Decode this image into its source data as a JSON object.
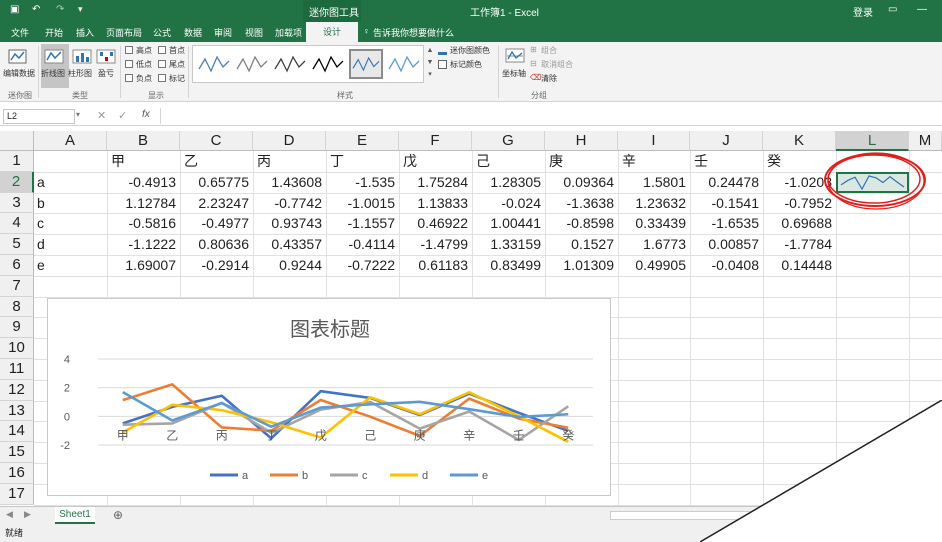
{
  "window": {
    "title": "工作簿1 - Excel",
    "context_tool": "迷你图工具",
    "signin": "登录"
  },
  "tabs": [
    "文件",
    "开始",
    "插入",
    "页面布局",
    "公式",
    "数据",
    "审阅",
    "视图",
    "加载项",
    "设计"
  ],
  "tell_me": "告诉我你想要做什么",
  "ribbon": {
    "edit_data": "编辑数据",
    "type_line": "折线图",
    "type_column": "柱形图",
    "type_winloss": "盈亏",
    "show": {
      "high": "高点",
      "first": "首点",
      "low": "低点",
      "last": "尾点",
      "negative": "负点",
      "markers": "标记"
    },
    "sparkline_color": "迷你图颜色",
    "marker_color": "标记颜色",
    "axis": "坐标轴",
    "group": "组合",
    "ungroup": "取消组合",
    "clear": "清除",
    "groups": {
      "sparkline": "迷你图",
      "type": "类型",
      "show": "显示",
      "style": "样式",
      "group": "分组"
    }
  },
  "formula_bar": {
    "name_box": "L2",
    "fx": "fx"
  },
  "columns": [
    "A",
    "B",
    "C",
    "D",
    "E",
    "F",
    "G",
    "H",
    "I",
    "J",
    "K",
    "L",
    "M"
  ],
  "rows": [
    "1",
    "2",
    "3",
    "4",
    "5",
    "6",
    "7",
    "8",
    "9",
    "10",
    "11",
    "12",
    "13",
    "14",
    "15",
    "16",
    "17"
  ],
  "sheet": {
    "headers": [
      "甲",
      "乙",
      "丙",
      "丁",
      "戊",
      "己",
      "庚",
      "辛",
      "壬",
      "癸"
    ],
    "data": [
      {
        "label": "a",
        "values": [
          "-0.4913",
          "0.65775",
          "1.43608",
          "-1.535",
          "1.75284",
          "1.28305",
          "0.09364",
          "1.5801",
          "0.24478",
          "-1.0203"
        ]
      },
      {
        "label": "b",
        "values": [
          "1.12784",
          "2.23247",
          "-0.7742",
          "-1.0015",
          "1.13833",
          "-0.024",
          "-1.3638",
          "1.23632",
          "-0.1541",
          "-0.7952"
        ]
      },
      {
        "label": "c",
        "values": [
          "-0.5816",
          "-0.4977",
          "0.93743",
          "-1.1557",
          "0.46922",
          "1.00441",
          "-0.8598",
          "0.33439",
          "-1.6535",
          "0.69688"
        ]
      },
      {
        "label": "d",
        "values": [
          "-1.1222",
          "0.80636",
          "0.43357",
          "-0.4114",
          "-1.4799",
          "1.33159",
          "0.1527",
          "1.6773",
          "0.00857",
          "-1.7784"
        ]
      },
      {
        "label": "e",
        "values": [
          "1.69007",
          "-0.2914",
          "0.9244",
          "-0.7222",
          "0.61183",
          "0.83499",
          "1.01309",
          "0.49905",
          "-0.0408",
          "0.14448"
        ]
      }
    ]
  },
  "sheet_tab": "Sheet1",
  "status": "就绪",
  "colors": {
    "excel_green": "#217346",
    "series_a": "#4472c4",
    "series_b": "#ed7d31",
    "series_c": "#a5a5a5",
    "series_d": "#ffc000",
    "series_e": "#5b9bd5",
    "annotation": "#e0201b"
  },
  "chart_data": {
    "type": "line",
    "title": "图表标题",
    "categories": [
      "甲",
      "乙",
      "丙",
      "丁",
      "戊",
      "己",
      "庚",
      "辛",
      "壬",
      "癸"
    ],
    "ylim": [
      -2,
      4
    ],
    "yticks": [
      "4",
      "2",
      "0",
      "-2"
    ],
    "grid": true,
    "legend_position": "bottom",
    "series": [
      {
        "name": "a",
        "values": [
          -0.4913,
          0.65775,
          1.43608,
          -1.535,
          1.75284,
          1.28305,
          0.09364,
          1.5801,
          0.24478,
          -1.0203
        ]
      },
      {
        "name": "b",
        "values": [
          1.12784,
          2.23247,
          -0.7742,
          -1.0015,
          1.13833,
          -0.024,
          -1.3638,
          1.23632,
          -0.1541,
          -0.7952
        ]
      },
      {
        "name": "c",
        "values": [
          -0.5816,
          -0.4977,
          0.93743,
          -1.1557,
          0.46922,
          1.00441,
          -0.8598,
          0.33439,
          -1.6535,
          0.69688
        ]
      },
      {
        "name": "d",
        "values": [
          -1.1222,
          0.80636,
          0.43357,
          -0.4114,
          -1.4799,
          1.33159,
          0.1527,
          1.6773,
          0.00857,
          -1.7784
        ]
      },
      {
        "name": "e",
        "values": [
          1.69007,
          -0.2914,
          0.9244,
          -0.7222,
          0.61183,
          0.83499,
          1.01309,
          0.49905,
          -0.0408,
          0.14448
        ]
      }
    ]
  }
}
